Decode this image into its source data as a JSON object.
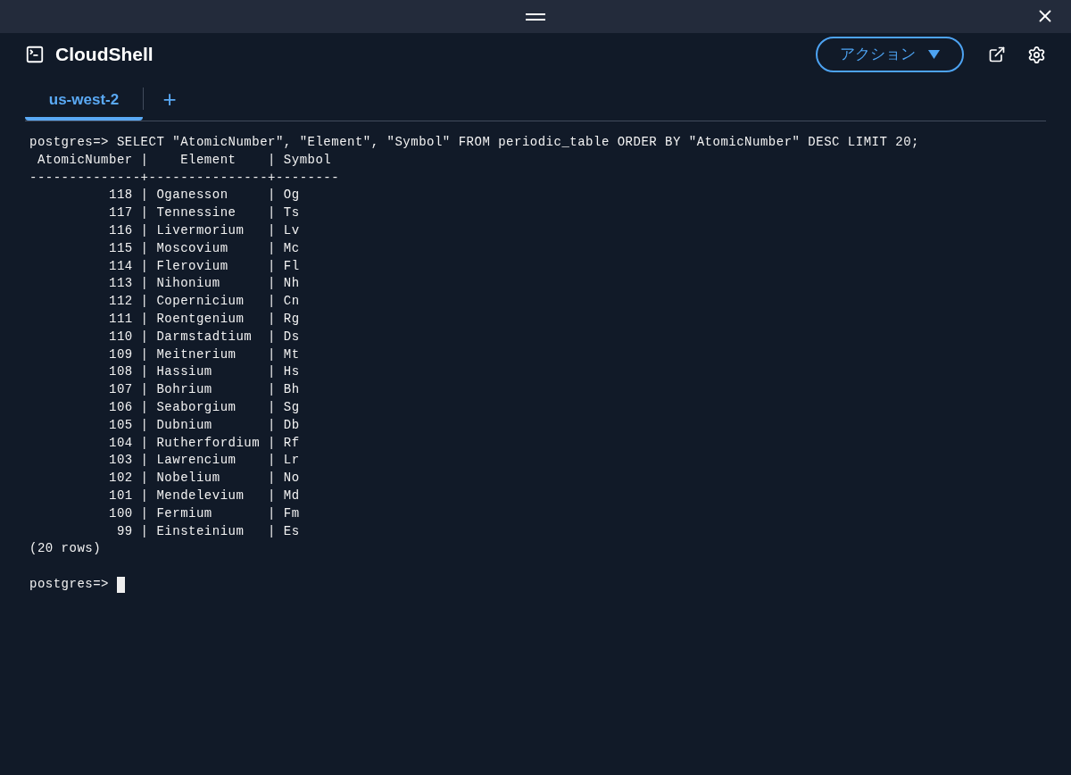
{
  "app": {
    "title": "CloudShell",
    "actions_button": "アクション"
  },
  "tabs": [
    {
      "label": "us-west-2",
      "selected": true
    }
  ],
  "new_tab": "+",
  "terminal": {
    "lines": [
      "postgres=> SELECT \"AtomicNumber\", \"Element\", \"Symbol\" FROM periodic_table ORDER BY \"AtomicNumber\" DESC LIMIT 20;",
      " AtomicNumber |    Element    | Symbol",
      "--------------+---------------+--------",
      "          118 | Oganesson     | Og",
      "          117 | Tennessine    | Ts",
      "          116 | Livermorium   | Lv",
      "          115 | Moscovium     | Mc",
      "          114 | Flerovium     | Fl",
      "          113 | Nihonium      | Nh",
      "          112 | Copernicium   | Cn",
      "          111 | Roentgenium   | Rg",
      "          110 | Darmstadtium  | Ds",
      "          109 | Meitnerium    | Mt",
      "          108 | Hassium       | Hs",
      "          107 | Bohrium       | Bh",
      "          106 | Seaborgium    | Sg",
      "          105 | Dubnium       | Db",
      "          104 | Rutherfordium | Rf",
      "          103 | Lawrencium    | Lr",
      "          102 | Nobelium      | No",
      "          101 | Mendelevium   | Md",
      "          100 | Fermium       | Fm",
      "           99 | Einsteinium   | Es",
      "(20 rows)"
    ],
    "prompt": "postgres=> "
  }
}
